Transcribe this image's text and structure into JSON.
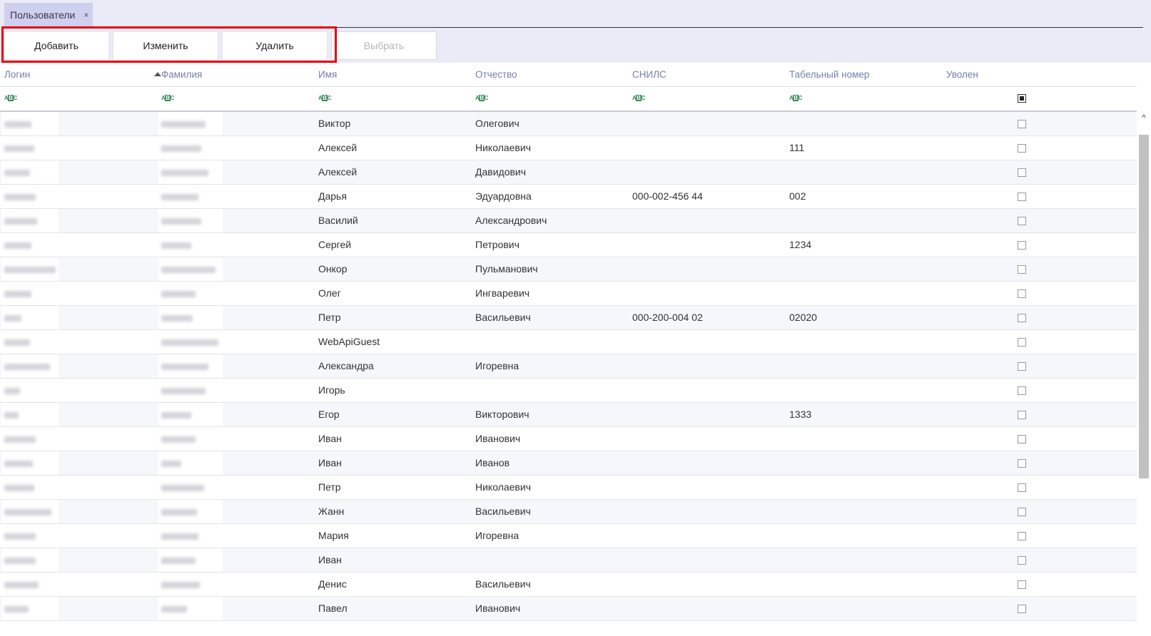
{
  "tabs": [
    {
      "label": "Пользователи",
      "close_glyph": "×"
    }
  ],
  "toolbar": {
    "add_label": "Добавить",
    "edit_label": "Изменить",
    "delete_label": "Удалить",
    "select_label": "Выбрать"
  },
  "highlight_color": "#e8000a",
  "grid": {
    "columns": [
      {
        "key": "login",
        "label": "Логин"
      },
      {
        "key": "surname",
        "label": "Фамилия",
        "sorted": "ascending"
      },
      {
        "key": "name",
        "label": "Имя"
      },
      {
        "key": "patronymic",
        "label": "Отчество"
      },
      {
        "key": "snils",
        "label": "СНИЛС"
      },
      {
        "key": "tab_number",
        "label": "Табельный номер"
      },
      {
        "key": "fired",
        "label": "Уволен"
      }
    ],
    "filter_icon": "text-filter-icon",
    "filter_icon_text": "ABC",
    "rows": [
      {
        "name": "Виктор",
        "patronymic": "Олегович",
        "snils": "",
        "tab_number": "",
        "fired": false
      },
      {
        "name": "Алексей",
        "patronymic": "Николаевич",
        "snils": "",
        "tab_number": "111",
        "fired": false
      },
      {
        "name": "Алексей",
        "patronymic": "Давидович",
        "snils": "",
        "tab_number": "",
        "fired": false
      },
      {
        "name": "Дарья",
        "patronymic": "Эдуардовна",
        "snils": "000-002-456 44",
        "tab_number": "002",
        "fired": false
      },
      {
        "name": "Василий",
        "patronymic": "Александрович",
        "snils": "",
        "tab_number": "",
        "fired": false
      },
      {
        "name": "Сергей",
        "patronymic": "Петрович",
        "snils": "",
        "tab_number": "1234",
        "fired": false
      },
      {
        "name": "Онкор",
        "patronymic": "Пульманович",
        "snils": "",
        "tab_number": "",
        "fired": false
      },
      {
        "name": "Олег",
        "patronymic": "Ингваревич",
        "snils": "",
        "tab_number": "",
        "fired": false
      },
      {
        "name": "Петр",
        "patronymic": "Васильевич",
        "snils": "000-200-004 02",
        "tab_number": "02020",
        "fired": false
      },
      {
        "name": "WebApiGuest",
        "patronymic": "",
        "snils": "",
        "tab_number": "",
        "fired": false
      },
      {
        "name": "Александра",
        "patronymic": "Игоревна",
        "snils": "",
        "tab_number": "",
        "fired": false
      },
      {
        "name": "Игорь",
        "patronymic": "",
        "snils": "",
        "tab_number": "",
        "fired": false
      },
      {
        "name": "Егор",
        "patronymic": "Викторович",
        "snils": "",
        "tab_number": "1333",
        "fired": false
      },
      {
        "name": "Иван",
        "patronymic": "Иванович",
        "snils": "",
        "tab_number": "",
        "fired": false
      },
      {
        "name": "Иван",
        "patronymic": "Иванов",
        "snils": "",
        "tab_number": "",
        "fired": false
      },
      {
        "name": "Петр",
        "patronymic": "Николаевич",
        "snils": "",
        "tab_number": "",
        "fired": false
      },
      {
        "name": "Жанн",
        "patronymic": "Васильевич",
        "snils": "",
        "tab_number": "",
        "fired": false
      },
      {
        "name": "Мария",
        "patronymic": "Игоревна",
        "snils": "",
        "tab_number": "",
        "fired": false
      },
      {
        "name": "Иван",
        "patronymic": "",
        "snils": "",
        "tab_number": "",
        "fired": false
      },
      {
        "name": "Денис",
        "patronymic": "Васильевич",
        "snils": "",
        "tab_number": "",
        "fired": false
      },
      {
        "name": "Павел",
        "patronymic": "Иванович",
        "snils": "",
        "tab_number": "",
        "fired": false
      }
    ]
  },
  "scrollbar": {
    "up_glyph": "^"
  }
}
